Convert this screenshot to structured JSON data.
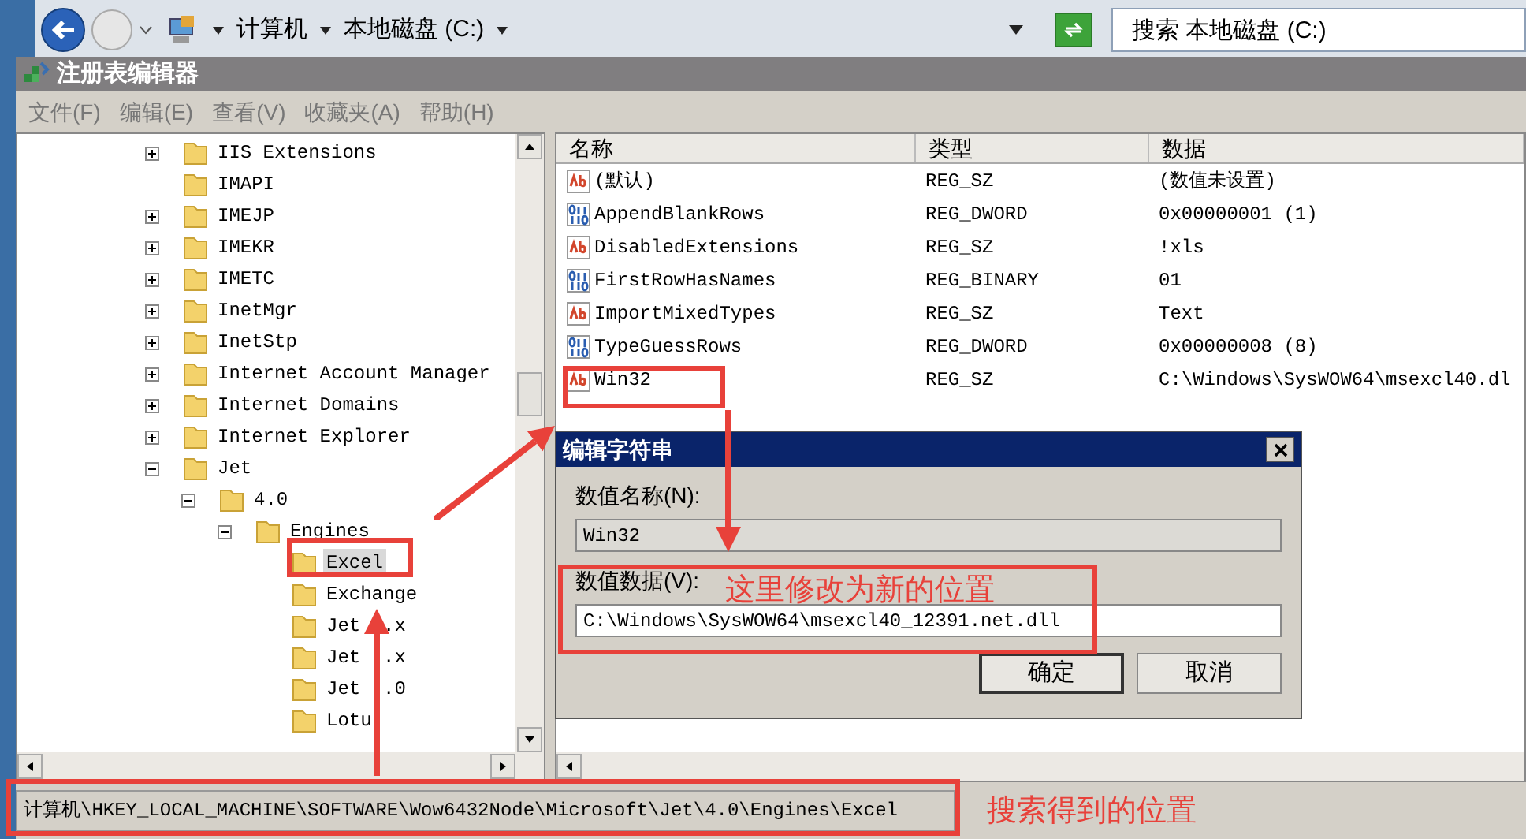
{
  "explorer_bar": {
    "breadcrumb": [
      "计算机",
      "本地磁盘 (C:)"
    ],
    "search": {
      "placeholder": "搜索 本地磁盘 (C:)"
    }
  },
  "window": {
    "title": "注册表编辑器"
  },
  "menu": [
    "文件(F)",
    "编辑(E)",
    "查看(V)",
    "收藏夹(A)",
    "帮助(H)"
  ],
  "tree": [
    {
      "label": "IIS Extensions",
      "expanded": false,
      "selected": false
    },
    {
      "label": "IMAPI",
      "selected": false
    },
    {
      "label": "IMEJP",
      "expanded": false,
      "selected": false
    },
    {
      "label": "IMEKR",
      "expanded": false,
      "selected": false
    },
    {
      "label": "IMETC",
      "expanded": false,
      "selected": false
    },
    {
      "label": "InetMgr",
      "expanded": false,
      "selected": false
    },
    {
      "label": "InetStp",
      "expanded": false,
      "selected": false
    },
    {
      "label": "Internet Account Manager",
      "expanded": false,
      "selected": false
    },
    {
      "label": "Internet Domains",
      "expanded": false,
      "selected": false
    },
    {
      "label": "Internet Explorer",
      "expanded": false,
      "selected": false
    },
    {
      "label": "Jet",
      "expanded": true,
      "selected": false,
      "children": [
        {
          "label": "4.0",
          "expanded": true,
          "selected": false,
          "children": [
            {
              "label": "Engines",
              "expanded": true,
              "selected": false,
              "children": [
                {
                  "label": "Excel",
                  "selected": true
                },
                {
                  "label": "Exchange",
                  "selected": false
                },
                {
                  "label": "Jet  .x",
                  "selected": false
                },
                {
                  "label": "Jet  .x",
                  "selected": false
                },
                {
                  "label": "Jet  .0",
                  "selected": false
                },
                {
                  "label": "Lotu",
                  "selected": false
                }
              ]
            }
          ]
        }
      ]
    }
  ],
  "values": {
    "columns": [
      "名称",
      "类型",
      "数据"
    ],
    "rows": [
      {
        "kind": "string",
        "name": "(默认)",
        "type": "REG_SZ",
        "data": "(数值未设置)"
      },
      {
        "kind": "binary",
        "name": "AppendBlankRows",
        "type": "REG_DWORD",
        "data": "0x00000001 (1)"
      },
      {
        "kind": "string",
        "name": "DisabledExtensions",
        "type": "REG_SZ",
        "data": "!xls"
      },
      {
        "kind": "binary",
        "name": "FirstRowHasNames",
        "type": "REG_BINARY",
        "data": "01"
      },
      {
        "kind": "string",
        "name": "ImportMixedTypes",
        "type": "REG_SZ",
        "data": "Text"
      },
      {
        "kind": "binary",
        "name": "TypeGuessRows",
        "type": "REG_DWORD",
        "data": "0x00000008 (8)"
      },
      {
        "kind": "string",
        "name": "Win32",
        "type": "REG_SZ",
        "data": "C:\\Windows\\SysWOW64\\msexcl40.dl"
      }
    ]
  },
  "dialog": {
    "title": "编辑字符串",
    "name_label": "数值名称(N):",
    "name_value": "Win32",
    "data_label": "数值数据(V):",
    "data_value": "C:\\Windows\\SysWOW64\\msexcl40_12391.net.dll",
    "buttons": [
      "确定",
      "取消"
    ]
  },
  "status_bar": "计算机\\HKEY_LOCAL_MACHINE\\SOFTWARE\\Wow6432Node\\Microsoft\\Jet\\4.0\\Engines\\Excel",
  "annotations": [
    "这里修改为新的位置",
    "搜索得到的位置"
  ]
}
